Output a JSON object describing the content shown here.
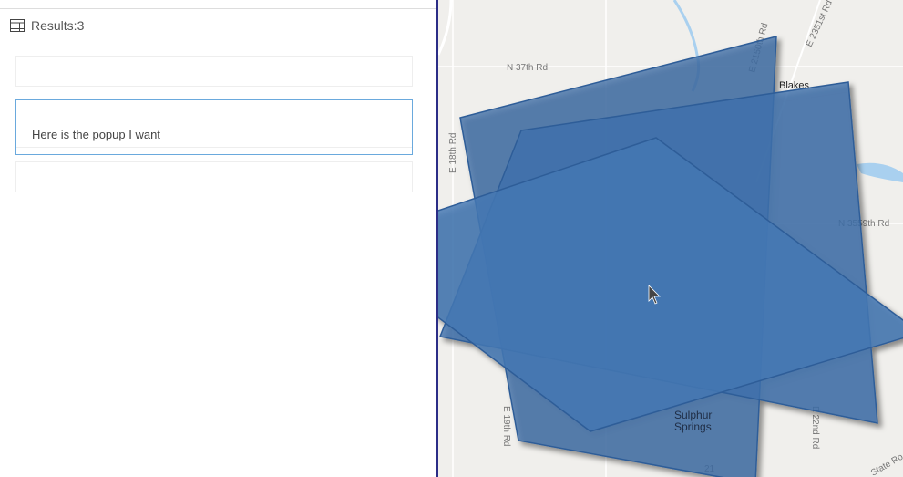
{
  "results": {
    "label": "Results:3",
    "icon": "table-icon"
  },
  "cards": [
    {
      "text": ""
    },
    {
      "text": "Here is the popup I want"
    },
    {
      "text": ""
    }
  ],
  "map": {
    "labels": {
      "n37": "N 37th Rd",
      "e2150": "E 2150th Rd",
      "e2351": "E 2351st Rd",
      "blakes": "Blakes",
      "e18": "E 18th Rd",
      "n3559": "N 3559th Rd",
      "e19": "E 19th Rd",
      "sulphur1": "Sulphur",
      "sulphur2": "Springs",
      "e22": "E 22nd Rd",
      "state": "State Ro",
      "route": "21"
    },
    "polygon_color": "#3f73ad"
  }
}
